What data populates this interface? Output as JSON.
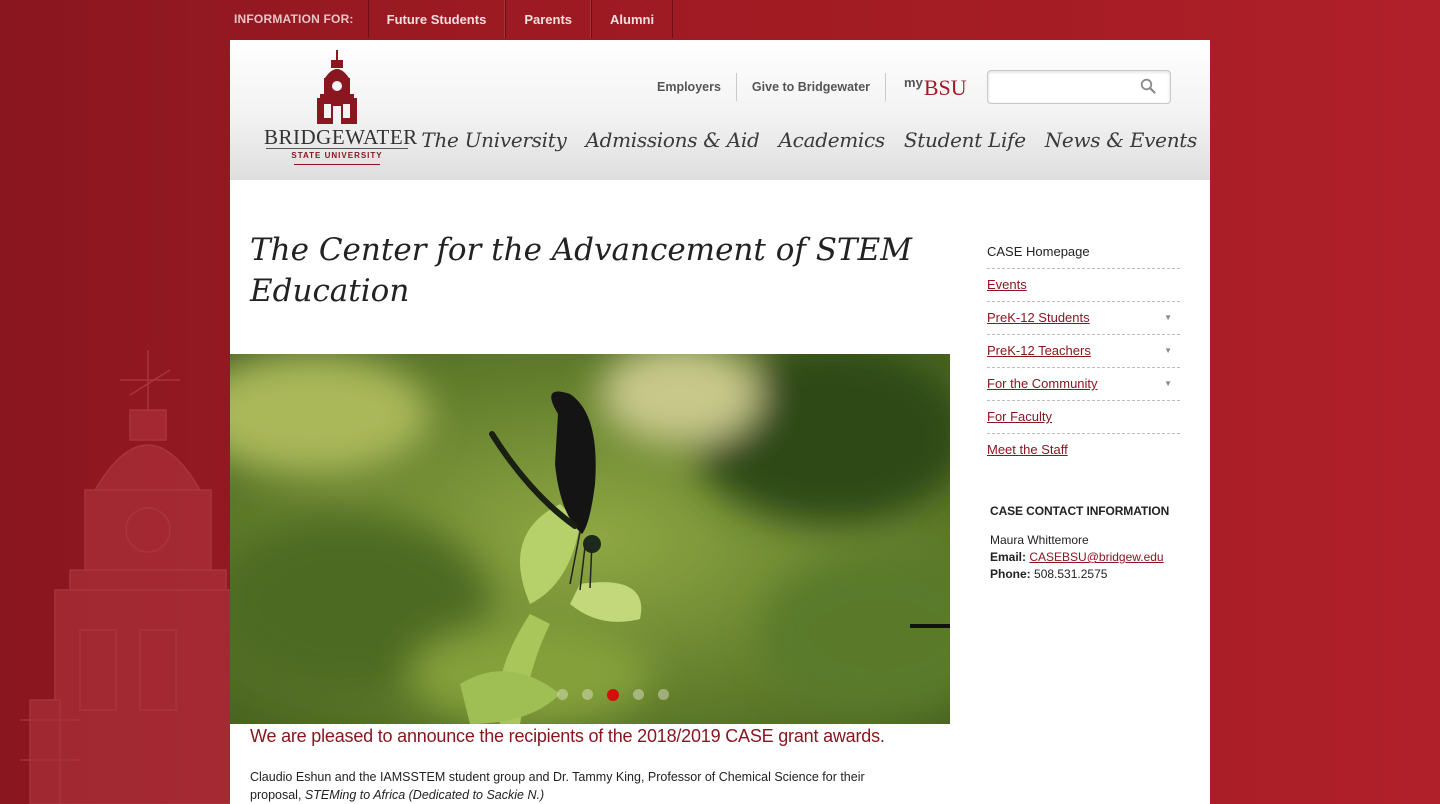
{
  "infobar": {
    "label": "INFORMATION FOR:",
    "links": [
      "Future Students",
      "Parents",
      "Alumni"
    ]
  },
  "logo": {
    "name": "BRIDGEWATER",
    "sub": "STATE UNIVERSITY"
  },
  "utility": {
    "links": [
      "Employers",
      "Give to Bridgewater"
    ],
    "mybsu_my": "my",
    "mybsu_bsu": "BSU",
    "search_placeholder": ""
  },
  "mainnav": [
    "The University",
    "Admissions & Aid",
    "Academics",
    "Student Life",
    "News & Events"
  ],
  "page": {
    "title": "The Center for the Advancement of STEM Education",
    "announcement": "We are pleased to announce the recipients of the 2018/2019  CASE grant awards.",
    "body_line1": "Claudio Eshun and the IAMSSTEM student group and Dr. Tammy King, Professor of Chemical Science for their",
    "body_prefix": "proposal, ",
    "body_italic": "STEMing to Africa (Dedicated to Sackie N.)"
  },
  "slideshow": {
    "dot_count": 5,
    "active_dot": 3
  },
  "sidenav": [
    {
      "label": "CASE Homepage",
      "home": true,
      "expandable": false
    },
    {
      "label": "Events",
      "home": false,
      "expandable": false
    },
    {
      "label": "PreK-12 Students",
      "home": false,
      "expandable": true
    },
    {
      "label": "PreK-12 Teachers",
      "home": false,
      "expandable": true
    },
    {
      "label": "For the Community",
      "home": false,
      "expandable": true
    },
    {
      "label": "For Faculty",
      "home": false,
      "expandable": false
    },
    {
      "label": "Meet the Staff",
      "home": false,
      "expandable": false
    }
  ],
  "contact": {
    "heading": "CASE CONTACT INFORMATION",
    "name": "Maura Whittemore",
    "email_label": "Email:",
    "email": "CASEBSU@bridgew.edu",
    "phone_label": "Phone:",
    "phone": "508.531.2575"
  },
  "colors": {
    "brand_red": "#8a1620",
    "active_dot": "#d40d0d"
  }
}
